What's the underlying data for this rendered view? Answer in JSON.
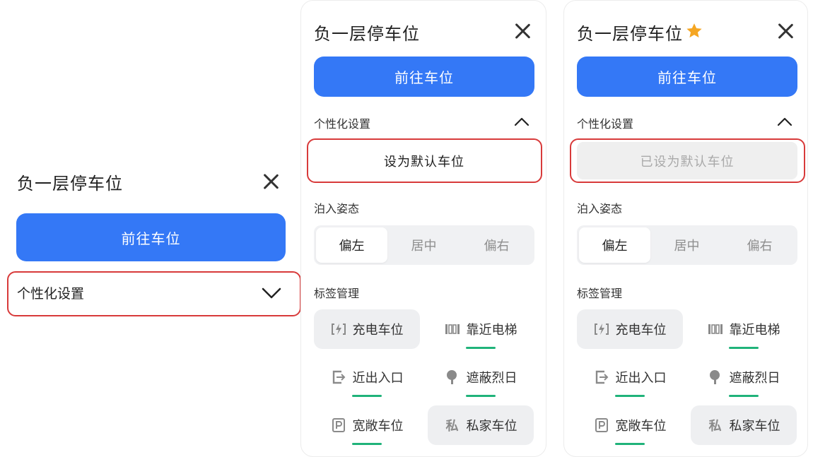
{
  "panel_title": "负一层停车位",
  "go_button": "前往车位",
  "personalize_label": "个性化设置",
  "set_default_label": "设为默认车位",
  "default_set_label": "已设为默认车位",
  "parking_pose_label": "泊入姿态",
  "pose_options": [
    "偏左",
    "居中",
    "偏右"
  ],
  "tag_manage_label": "标签管理",
  "tags": [
    {
      "label": "充电车位",
      "icon": "charging-icon"
    },
    {
      "label": "靠近电梯",
      "icon": "elevator-icon"
    },
    {
      "label": "近出入口",
      "icon": "exit-entrance-icon"
    },
    {
      "label": "遮蔽烈日",
      "icon": "shade-tree-icon"
    },
    {
      "label": "宽敞车位",
      "icon": "parking-p-icon"
    },
    {
      "label": "私家车位",
      "icon": "private-icon",
      "icon_text": "私"
    }
  ],
  "colors": {
    "primary": "#3478f6",
    "highlight": "#d83a3a",
    "underline": "#20b37a",
    "star": "#f5a623"
  }
}
